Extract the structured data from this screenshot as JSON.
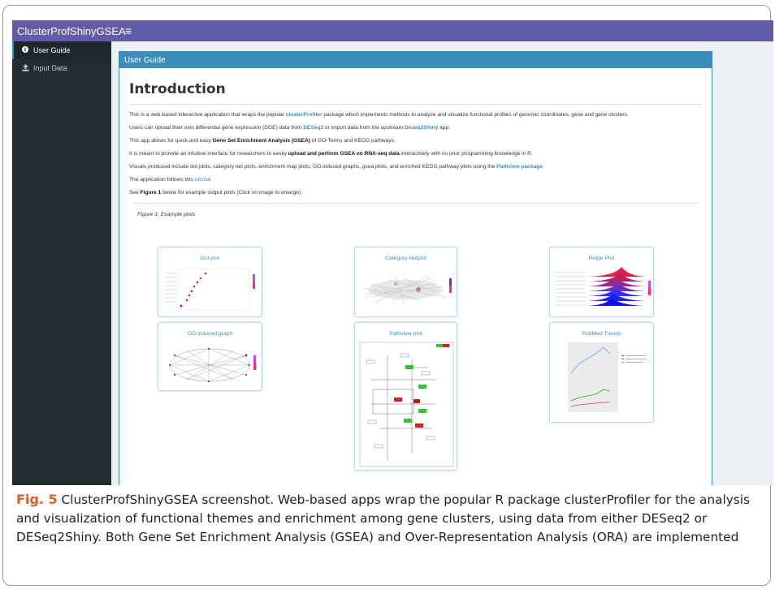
{
  "app": {
    "title": "ClusterProfShinyGSEA",
    "menu_icon": "hamburger-icon"
  },
  "sidebar": {
    "items": [
      {
        "label": "User Guide",
        "icon": "info-circle-icon",
        "active": true
      },
      {
        "label": "Input Data",
        "icon": "upload-icon",
        "active": false
      }
    ]
  },
  "box": {
    "header": "User Guide",
    "heading": "Introduction"
  },
  "paragraphs": {
    "p1": {
      "a": "This is a web-based interactive application that wraps the popular ",
      "link": "clusterProfiler",
      "b": " package which implements methods to analyze and visualize functional profiles of genomic coordinates, gene and gene clusters."
    },
    "p2": {
      "a": "Users can upload their own differential gene expression (DGE) data from ",
      "link1": "DESeq2",
      "b": " or import data from the upstream ",
      "link2": "Deseq2Shiny",
      "c": " app."
    },
    "p3": {
      "a": "This app allows for quick and easy ",
      "bold": "Gene Set Enrichment Analysis (GSEA)",
      "b": " of GO-Terms and KEGG pathways."
    },
    "p4": {
      "a": "It is meant to provide an intuitive interface for researchers to easily ",
      "bold": "upload and perform GSEA on RNA-seq data",
      "b": " interactively with no prior programming knowledge in R."
    },
    "p5": {
      "a": "Visuals produced include dot plots, category net plots, enrichment map plots, GO induced graphs, gsea plots, and enriched KEGG pathway plots using the ",
      "link": "Pathview package",
      "b": "."
    },
    "p6": {
      "a": "The application follows this ",
      "link": "tutorial"
    },
    "p7": {
      "a": "See ",
      "bold": "Figure 1",
      "b": " below for example output plots (Click on image to enlarge)."
    }
  },
  "figure": {
    "label": "Figure 1: Example plots",
    "cards": [
      {
        "title": "Dot plot"
      },
      {
        "title": "Category Netplot"
      },
      {
        "title": "Ridge Plot"
      },
      {
        "title": "GO induced graph"
      },
      {
        "title": "Pathview plot"
      },
      {
        "title": "PubMed Trends"
      }
    ]
  },
  "caption": {
    "fig": "Fig. 5",
    "text": "ClusterProfShinyGSEA screenshot. Web-based apps wrap the popular R package clusterProfiler for the analysis and visualization of functional themes and enrichment among gene clusters, using data from either DESeq2 or DESeq2Shiny. Both Gene Set Enrichment Analysis (GSEA) and Over-Representation Analysis (ORA) are implemented"
  },
  "colors": {
    "topbar": "#605ca8",
    "sidebar": "#222d32",
    "accent": "#3c8dbc",
    "caption_label": "#e65a1f"
  }
}
